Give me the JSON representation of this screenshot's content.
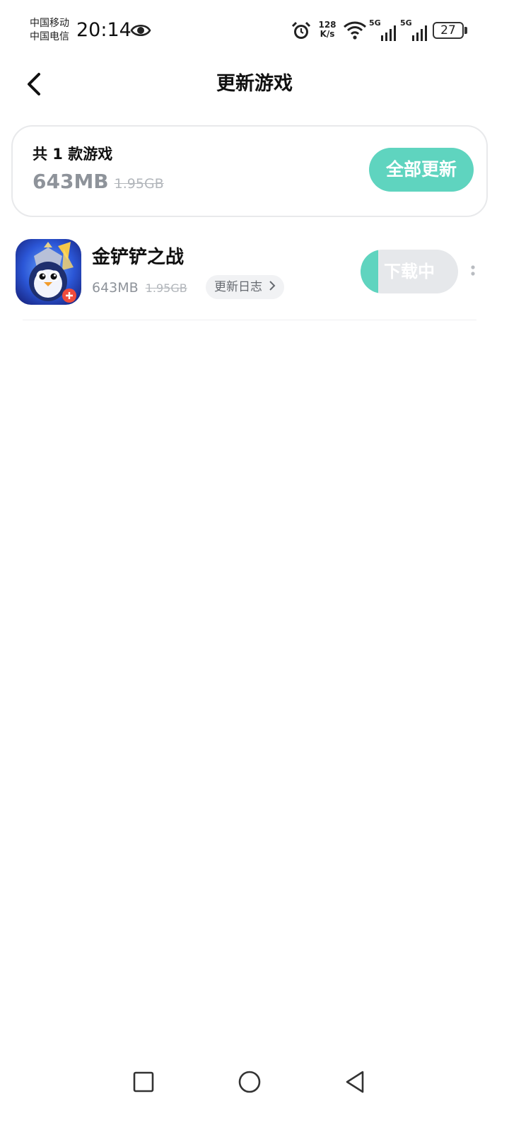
{
  "status_bar": {
    "carrier_1": "中国移动",
    "carrier_2": "中国电信",
    "time": "20:14",
    "net_speed_value": "128",
    "net_speed_unit": "K/s",
    "signal_1_tag": "5G",
    "signal_2_tag": "5G",
    "battery_level": "27",
    "icons": [
      "eye-icon",
      "alarm-icon",
      "wifi-icon",
      "signal-icon",
      "battery-icon"
    ]
  },
  "nav": {
    "title": "更新游戏",
    "back_icon": "chevron-left-icon"
  },
  "summary": {
    "count_text": "共 1 款游戏",
    "download_size": "643MB",
    "full_size": "1.95GB",
    "update_all_label": "全部更新"
  },
  "games": [
    {
      "name": "金铲铲之战",
      "download_size": "643MB",
      "full_size": "1.95GB",
      "changelog_label": "更新日志",
      "changelog_icon": "chevron-right-icon",
      "status_label": "下载中",
      "download_progress": 0.18,
      "more_icon": "more-vertical-icon"
    }
  ],
  "system_nav": {
    "icons": [
      "recent-apps-icon",
      "home-icon",
      "back-triangle-icon"
    ]
  },
  "colors": {
    "accent": "#5fd4bf",
    "muted_text": "#8e939a",
    "strike_text": "#b2b6bb",
    "button_bg": "#e6e8eb"
  }
}
